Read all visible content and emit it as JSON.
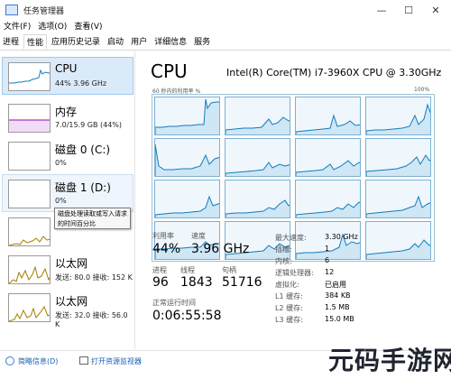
{
  "window": {
    "title": "任务管理器",
    "minimize": "—",
    "maximize": "☐",
    "close": "✕"
  },
  "menu": [
    "文件(F)",
    "选项(O)",
    "查看(V)"
  ],
  "tabs": [
    {
      "label": "进程"
    },
    {
      "label": "性能",
      "active": true
    },
    {
      "label": "应用历史记录"
    },
    {
      "label": "启动"
    },
    {
      "label": "用户"
    },
    {
      "label": "详细信息"
    },
    {
      "label": "服务"
    }
  ],
  "sidebar": [
    {
      "name": "CPU",
      "sub": "44%  3.96 GHz",
      "color": "#117dbb",
      "selected": true
    },
    {
      "name": "内存",
      "sub": "7.0/15.9 GB (44%)",
      "color": "#8b12ae"
    },
    {
      "name": "磁盘 0 (C:)",
      "sub": "0%",
      "color": "#4da60c"
    },
    {
      "name": "磁盘 1 (D:)",
      "sub": "0%",
      "color": "#4da60c",
      "hover": true
    },
    {
      "name": "",
      "sub": "",
      "color": "#a77a00"
    },
    {
      "name": "以太网",
      "sub": "发送: 80.0  接收: 152 K",
      "color": "#a77a00"
    },
    {
      "name": "以太网",
      "sub": "发送: 32.0  接收: 56.0 K",
      "color": "#a77a00"
    }
  ],
  "tooltip": "磁盘处理读取或写入请求的时间百分比",
  "main": {
    "title": "CPU",
    "model": "Intel(R) Core(TM) i7-3960X CPU @ 3.30GHz",
    "util_label": "60 秒内的利用率 %",
    "max_label": "100%"
  },
  "stats": {
    "util_label": "利用率",
    "util": "44%",
    "speed_label": "速度",
    "speed": "3.96 GHz",
    "proc_label": "进程",
    "proc": "96",
    "thread_label": "线程",
    "thread": "1843",
    "handle_label": "句柄",
    "handle": "51716",
    "uptime_label": "正常运行时间",
    "uptime": "0:06:55:58"
  },
  "specs": [
    {
      "label": "最大速度:",
      "value": "3.30 GHz"
    },
    {
      "label": "插槽:",
      "value": "1"
    },
    {
      "label": "内核:",
      "value": "6"
    },
    {
      "label": "逻辑处理器:",
      "value": "12"
    },
    {
      "label": "虚拟化:",
      "value": "已启用"
    },
    {
      "label": "L1 缓存:",
      "value": "384 KB"
    },
    {
      "label": "L2 缓存:",
      "value": "1.5 MB"
    },
    {
      "label": "L3 缓存:",
      "value": "15.0 MB"
    }
  ],
  "footer": {
    "brief": "简略信息(D)",
    "monitor": "打开资源监视器"
  },
  "watermark": "元码手游网"
}
